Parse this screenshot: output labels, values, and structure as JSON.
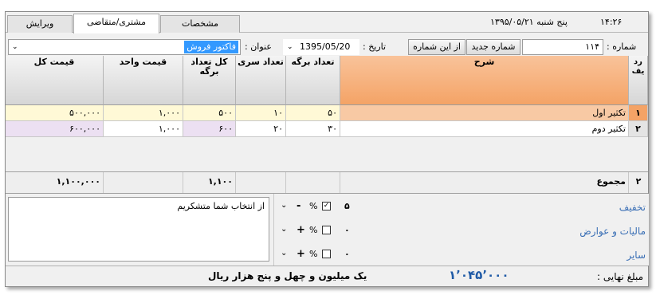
{
  "header": {
    "time": "۱۴:۲۶",
    "date_text": "پنج شنبه  ۱۳۹۵/۰۵/۲۱",
    "tabs": [
      {
        "label": "مشخصات",
        "active": false
      },
      {
        "label": "مشتری/متقاضی",
        "active": true
      },
      {
        "label": "ویرایش",
        "active": false
      }
    ]
  },
  "form": {
    "number_label": ": شماره",
    "number_value": "۱۱۴",
    "new_number_button": "شماره جدید",
    "from_this_number_button": "از این شماره",
    "date_label": ": تاریخ",
    "date_value": "1395/05/20",
    "title_label": ": عنوان",
    "title_value": "فاکتور فروش"
  },
  "grid": {
    "headers": {
      "row": "رد یف",
      "description": "شرح",
      "sheets": "تعداد برگه",
      "series": "تعداد سری",
      "total_sheets": "کل تعداد برگه",
      "unit_price": "قیمت واحد",
      "total_price": "قیمت کل"
    },
    "rows": [
      {
        "row": "۱",
        "description": "تکثیر اول",
        "sheets": "۵۰",
        "series": "۱۰",
        "total_sheets": "۵۰۰",
        "unit_price": "۱,۰۰۰",
        "total_price": "۵۰۰,۰۰۰"
      },
      {
        "row": "۲",
        "description": "تکثیر دوم",
        "sheets": "۳۰",
        "series": "۲۰",
        "total_sheets": "۶۰۰",
        "unit_price": "۱,۰۰۰",
        "total_price": "۶۰۰,۰۰۰"
      }
    ],
    "totals": {
      "row_count": "۲",
      "label": "مجموع",
      "total_sheets": "۱,۱۰۰",
      "total_price": "۱,۱۰۰,۰۰۰"
    }
  },
  "memo": {
    "text": "از انتخاب شما متشکریم"
  },
  "adjustments": [
    {
      "label": "تخفیف",
      "value": "۵",
      "checked": true,
      "sign": "-",
      "percent": "%"
    },
    {
      "label": "مالیات و عوارض",
      "value": "۰",
      "checked": false,
      "sign": "+",
      "percent": "%"
    },
    {
      "label": "سایر",
      "value": "۰",
      "checked": false,
      "sign": "+",
      "percent": "%"
    }
  ],
  "final": {
    "label": ": مبلغ نهایی",
    "amount": "۱٬۰۴۵٬۰۰۰",
    "words": "یک میلیون و چهل و پنج هزار  ریال"
  },
  "colors": {
    "selected_row": "#fff9d6",
    "header_accent": "#f5b07e",
    "purple_cell": "#ece0f2",
    "amount_blue": "#1f5aa6",
    "link_blue": "#3a6fb5"
  }
}
